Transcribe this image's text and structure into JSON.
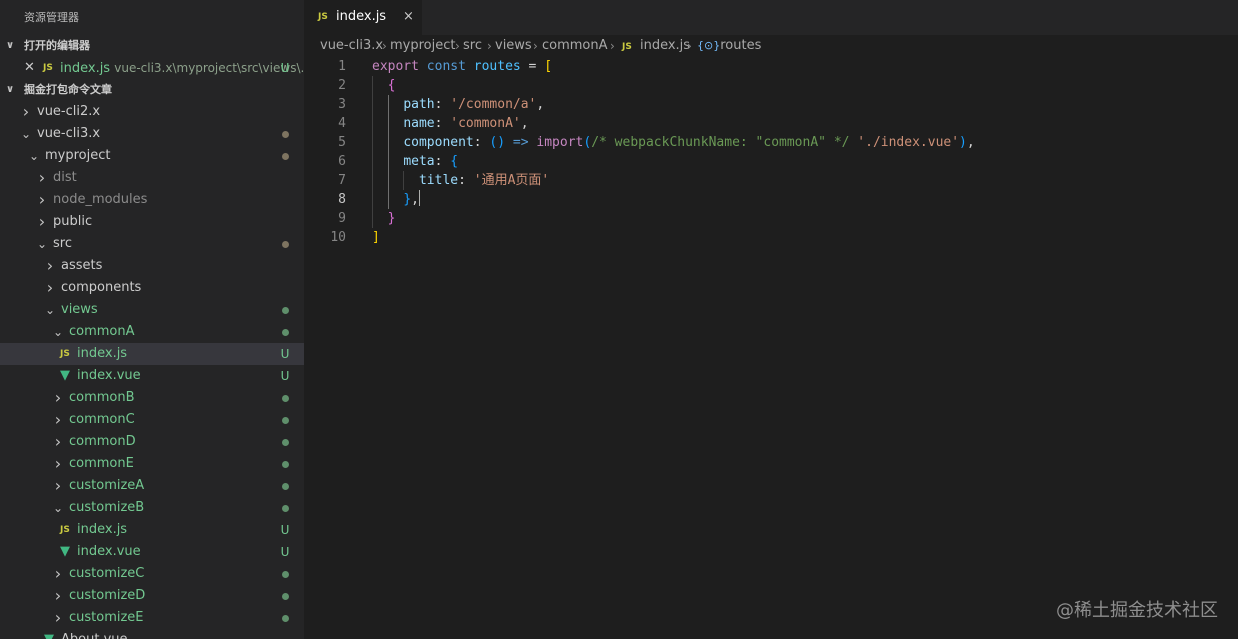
{
  "explorer": {
    "title": "资源管理器",
    "open_editors_title": "打开的编辑器",
    "open_editor": {
      "name": "index.js",
      "path": "vue-cli3.x\\myproject\\src\\views\\...",
      "badge": "U",
      "icon": "js-file-icon"
    },
    "workspace_title": "掘金打包命令文章",
    "tree": [
      {
        "label": "vue-cli2.x",
        "kind": "folder",
        "expanded": false,
        "depth": 0,
        "color": "white"
      },
      {
        "label": "vue-cli3.x",
        "kind": "folder",
        "expanded": true,
        "depth": 0,
        "color": "tan",
        "badge": "dot"
      },
      {
        "label": "myproject",
        "kind": "folder",
        "expanded": true,
        "depth": 1,
        "color": "tan",
        "badge": "dot"
      },
      {
        "label": "dist",
        "kind": "folder",
        "expanded": false,
        "depth": 2,
        "color": "dim"
      },
      {
        "label": "node_modules",
        "kind": "folder",
        "expanded": false,
        "depth": 2,
        "color": "dim"
      },
      {
        "label": "public",
        "kind": "folder",
        "expanded": false,
        "depth": 2,
        "color": "white"
      },
      {
        "label": "src",
        "kind": "folder",
        "expanded": true,
        "depth": 2,
        "color": "tan",
        "badge": "dot"
      },
      {
        "label": "assets",
        "kind": "folder",
        "expanded": false,
        "depth": 3,
        "color": "white"
      },
      {
        "label": "components",
        "kind": "folder",
        "expanded": false,
        "depth": 3,
        "color": "white"
      },
      {
        "label": "views",
        "kind": "folder",
        "expanded": true,
        "depth": 3,
        "color": "green",
        "badge": "dot"
      },
      {
        "label": "commonA",
        "kind": "folder",
        "expanded": true,
        "depth": 4,
        "color": "green",
        "badge": "dot"
      },
      {
        "label": "index.js",
        "kind": "js",
        "depth": 5,
        "color": "green",
        "badge": "U",
        "selected": true
      },
      {
        "label": "index.vue",
        "kind": "vue",
        "depth": 5,
        "color": "green",
        "badge": "U"
      },
      {
        "label": "commonB",
        "kind": "folder",
        "expanded": false,
        "depth": 4,
        "color": "green",
        "badge": "dot"
      },
      {
        "label": "commonC",
        "kind": "folder",
        "expanded": false,
        "depth": 4,
        "color": "green",
        "badge": "dot"
      },
      {
        "label": "commonD",
        "kind": "folder",
        "expanded": false,
        "depth": 4,
        "color": "green",
        "badge": "dot"
      },
      {
        "label": "commonE",
        "kind": "folder",
        "expanded": false,
        "depth": 4,
        "color": "green",
        "badge": "dot"
      },
      {
        "label": "customizeA",
        "kind": "folder",
        "expanded": false,
        "depth": 4,
        "color": "green",
        "badge": "dot"
      },
      {
        "label": "customizeB",
        "kind": "folder",
        "expanded": true,
        "depth": 4,
        "color": "green",
        "badge": "dot"
      },
      {
        "label": "index.js",
        "kind": "js",
        "depth": 5,
        "color": "green",
        "badge": "U"
      },
      {
        "label": "index.vue",
        "kind": "vue",
        "depth": 5,
        "color": "green",
        "badge": "U"
      },
      {
        "label": "customizeC",
        "kind": "folder",
        "expanded": false,
        "depth": 4,
        "color": "green",
        "badge": "dot"
      },
      {
        "label": "customizeD",
        "kind": "folder",
        "expanded": false,
        "depth": 4,
        "color": "green",
        "badge": "dot"
      },
      {
        "label": "customizeE",
        "kind": "folder",
        "expanded": false,
        "depth": 4,
        "color": "green",
        "badge": "dot"
      },
      {
        "label": "About.vue",
        "kind": "vue",
        "depth": 3,
        "color": "white"
      }
    ]
  },
  "tab": {
    "label": "index.js",
    "icon_text": "JS",
    "close": "×"
  },
  "breadcrumb": {
    "parts": [
      "vue-cli3.x",
      "myproject",
      "src",
      "views",
      "commonA"
    ],
    "file": "index.js",
    "symbol": "routes",
    "file_icon": "JS",
    "symbol_icon": "{⊙}"
  },
  "editor": {
    "active_line": 8,
    "line_numbers": [
      "1",
      "2",
      "3",
      "4",
      "5",
      "6",
      "7",
      "8",
      "9",
      "10"
    ],
    "lines": [
      [
        [
          "kw",
          "export"
        ],
        [
          "p",
          " "
        ],
        [
          "blue",
          "const"
        ],
        [
          "p",
          " "
        ],
        [
          "var",
          "routes"
        ],
        [
          "p",
          " = "
        ],
        [
          "br1",
          "["
        ]
      ],
      [
        [
          "p",
          "  "
        ],
        [
          "br2",
          "{"
        ]
      ],
      [
        [
          "p",
          "    "
        ],
        [
          "prop",
          "path"
        ],
        [
          "p",
          ": "
        ],
        [
          "str",
          "'/common/a'"
        ],
        [
          "p",
          ","
        ]
      ],
      [
        [
          "p",
          "    "
        ],
        [
          "prop",
          "name"
        ],
        [
          "p",
          ": "
        ],
        [
          "str",
          "'commonA'"
        ],
        [
          "p",
          ","
        ]
      ],
      [
        [
          "p",
          "    "
        ],
        [
          "prop",
          "component"
        ],
        [
          "p",
          ": "
        ],
        [
          "br3",
          "()"
        ],
        [
          "p",
          " "
        ],
        [
          "blue",
          "=>"
        ],
        [
          "p",
          " "
        ],
        [
          "kw",
          "import"
        ],
        [
          "br3",
          "("
        ],
        [
          "com",
          "/* webpackChunkName: \"commonA\" */"
        ],
        [
          "p",
          " "
        ],
        [
          "str",
          "'./index.vue'"
        ],
        [
          "br3",
          ")"
        ],
        [
          "p",
          ","
        ]
      ],
      [
        [
          "p",
          "    "
        ],
        [
          "prop",
          "meta"
        ],
        [
          "p",
          ": "
        ],
        [
          "br3",
          "{"
        ]
      ],
      [
        [
          "p",
          "      "
        ],
        [
          "prop",
          "title"
        ],
        [
          "p",
          ": "
        ],
        [
          "str",
          "'通用A页面'"
        ]
      ],
      [
        [
          "p",
          "    "
        ],
        [
          "br3",
          "}"
        ],
        [
          "p",
          ","
        ],
        [
          "cursor",
          ""
        ]
      ],
      [
        [
          "p",
          "  "
        ],
        [
          "br2",
          "}"
        ]
      ],
      [
        [
          "br1",
          "]"
        ]
      ]
    ]
  },
  "watermark": "@稀土掘金技术社区",
  "colors": {
    "background": "#1e1e1e",
    "sidebar": "#252526",
    "git_untracked": "#73c991",
    "js_icon": "#cbcb41",
    "vue_icon": "#41b883"
  }
}
